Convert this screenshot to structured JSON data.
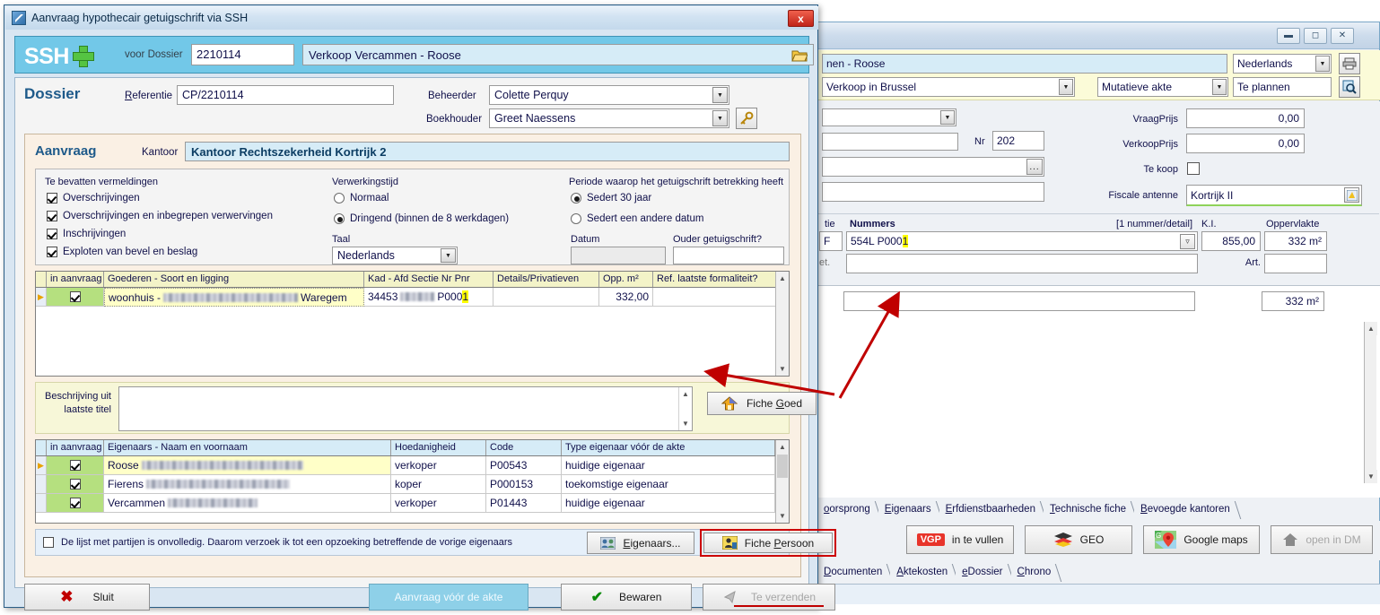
{
  "dialog": {
    "title": "Aanvraag hypothecair getuigschrift via SSH",
    "title_icon": "app-icon",
    "close_label": "x",
    "header": {
      "logo": "SSH",
      "plus_icon": "plus-icon",
      "dossier_label": "voor Dossier",
      "dossier_value": "2210114",
      "dossier_name": "Verkoop Vercammen - Roose",
      "folder_icon": "folder-icon"
    },
    "dossier": {
      "section_title": "Dossier",
      "referentie_label": "Referentie",
      "referentie_value": "CP/2210114",
      "beheerder_label": "Beheerder",
      "beheerder_value": "Colette Perquy",
      "boekhouder_label": "Boekhouder",
      "boekhouder_value": "Greet Naessens",
      "key_icon": "key-icon"
    },
    "aanvraag": {
      "section_title": "Aanvraag",
      "kantoor_label": "Kantoor",
      "kantoor_value": "Kantoor Rechtszekerheid Kortrijk 2",
      "groups": {
        "vermeldingen_title": "Te bevatten vermeldingen",
        "vermeldingen": [
          {
            "label": "Overschrijvingen",
            "checked": true
          },
          {
            "label": "Overschrijvingen en inbegrepen verwervingen",
            "checked": true
          },
          {
            "label": "Inschrijvingen",
            "checked": true
          },
          {
            "label": "Exploten van bevel en beslag",
            "checked": true
          }
        ],
        "verwerkingstijd_title": "Verwerkingstijd",
        "verwerkingstijd": [
          {
            "label": "Normaal",
            "selected": false
          },
          {
            "label": "Dringend (binnen de 8 werkdagen)",
            "selected": true
          }
        ],
        "taal_label": "Taal",
        "taal_value": "Nederlands",
        "periode_title": "Periode waarop het getuigschrift betrekking heeft",
        "periode": [
          {
            "label": "Sedert 30 jaar",
            "selected": true
          },
          {
            "label": "Sedert een andere datum",
            "selected": false
          }
        ],
        "datum_label": "Datum",
        "datum_value": "",
        "ouder_label": "Ouder getuigschrift?",
        "ouder_value": ""
      },
      "goederen_grid": {
        "headers": [
          "in aanvraag",
          "Goederen - Soort en ligging",
          "Kad - Afd Sectie Nr Pnr",
          "Details/Privatieven",
          "Opp. m²",
          "Ref. laatste formaliteit?"
        ],
        "rows": [
          {
            "checked": true,
            "soort_prefix": "woonhuis  -",
            "soort_suffix": "Waregem",
            "kad_prefix": "34453",
            "kad_mid": "P000",
            "kad_highlight": "1",
            "details": "",
            "opp": "332,00",
            "ref": ""
          }
        ]
      },
      "beschrijving_label_line1": "Beschrijving uit",
      "beschrijving_label_line2": "laatste titel",
      "beschrijving_value": "",
      "fiche_goed_label": "Fiche Goed",
      "fiche_goed_icon": "house-icon",
      "eigenaars_grid": {
        "headers": [
          "in aanvraag",
          "Eigenaars - Naam en voornaam",
          "Hoedanigheid",
          "Code",
          "Type eigenaar vóór de akte"
        ],
        "rows": [
          {
            "checked": true,
            "naam": "Roose",
            "hoedanigheid": "verkoper",
            "code": "P00543",
            "type": "huidige eigenaar"
          },
          {
            "checked": true,
            "naam": "Fierens",
            "hoedanigheid": "koper",
            "code": "P000153",
            "type": "toekomstige eigenaar"
          },
          {
            "checked": true,
            "naam": "Vercammen",
            "hoedanigheid": "verkoper",
            "code": "P01443",
            "type": "huidige eigenaar"
          }
        ]
      },
      "onvolledig_checkbox": {
        "checked": false,
        "label": "De lijst met partijen is onvolledig. Daarom verzoek ik tot een opzoeking betreffende de vorige eigenaars"
      },
      "eigenaars_button": "Eigenaars...",
      "eigenaars_button_icon": "people-icon",
      "fiche_persoon_button": "Fiche Persoon",
      "fiche_persoon_icon": "person-card-icon"
    },
    "buttons": {
      "sluit": "Sluit",
      "sluit_icon": "x-icon",
      "aanvraag_voor_akte": "Aanvraag vóór de akte",
      "bewaren": "Bewaren",
      "bewaren_icon": "check-icon",
      "te_verzenden": "Te verzenden",
      "te_verzenden_icon": "send-icon"
    }
  },
  "background_window": {
    "window_buttons": {
      "minimize": "minimize-icon",
      "maximize": "maximize-icon",
      "close": "close-icon"
    },
    "dossier_name_partial": "nen - Roose",
    "taal_value": "Nederlands",
    "print_icon": "printer-icon",
    "aktetype_value": "Verkoop in Brussel",
    "mutatie_value": "Mutatieve akte",
    "planning_value": "Te plannen",
    "search_icon": "search-icon",
    "nr_label": "Nr",
    "nr_value": "202",
    "ellipsis_button": "...",
    "vraagprijs_label": "VraagPrijs",
    "vraagprijs_value": "0,00",
    "verkoopprijs_label": "VerkoopPrijs",
    "verkoopprijs_value": "0,00",
    "tekoop_label": "Te koop",
    "tekoop_checked": false,
    "fiscale_antenne_label": "Fiscale antenne",
    "fiscale_antenne_value": "Kortrijk II",
    "fiscale_antenne_icon": "picker-icon",
    "nummers": {
      "sectie_label_partial": "tie",
      "sectie_value": "F",
      "nummers_label": "Nummers",
      "nummer_detail_hint": "[1 nummer/detail]",
      "ki_label": "K.I.",
      "oppervlakte_label": "Oppervlakte",
      "nummer_value_main": "554L P000",
      "nummer_value_highlight": "1",
      "ki_value": "855,00",
      "opp_value": "332 m²",
      "detail_label_partial": "et.",
      "art_label": "Art.",
      "art_value": "",
      "total_opp_value": "332 m²",
      "dropdown_icon": "chevron-double-down-icon"
    },
    "tabs_top": [
      "oorsprong",
      "Eigenaars",
      "Erfdienstbaarheden",
      "Technische fiche",
      "Bevoegde kantoren"
    ],
    "action_buttons": [
      {
        "label": "in te vullen",
        "icon": "vgp-icon",
        "enabled": true
      },
      {
        "label": "GEO",
        "icon": "layers-icon",
        "enabled": true
      },
      {
        "label": "Google maps",
        "icon": "map-pin-icon",
        "enabled": true
      },
      {
        "label": "open in DM",
        "icon": "home-icon",
        "enabled": false
      }
    ],
    "tabs_bottom": [
      "Documenten",
      "Aktekosten",
      "eDossier",
      "Chrono"
    ]
  },
  "annotation": {
    "arrow_color": "#c00000",
    "highlight_color": "#ffff00",
    "highlight_box_color": "#cc0000"
  }
}
